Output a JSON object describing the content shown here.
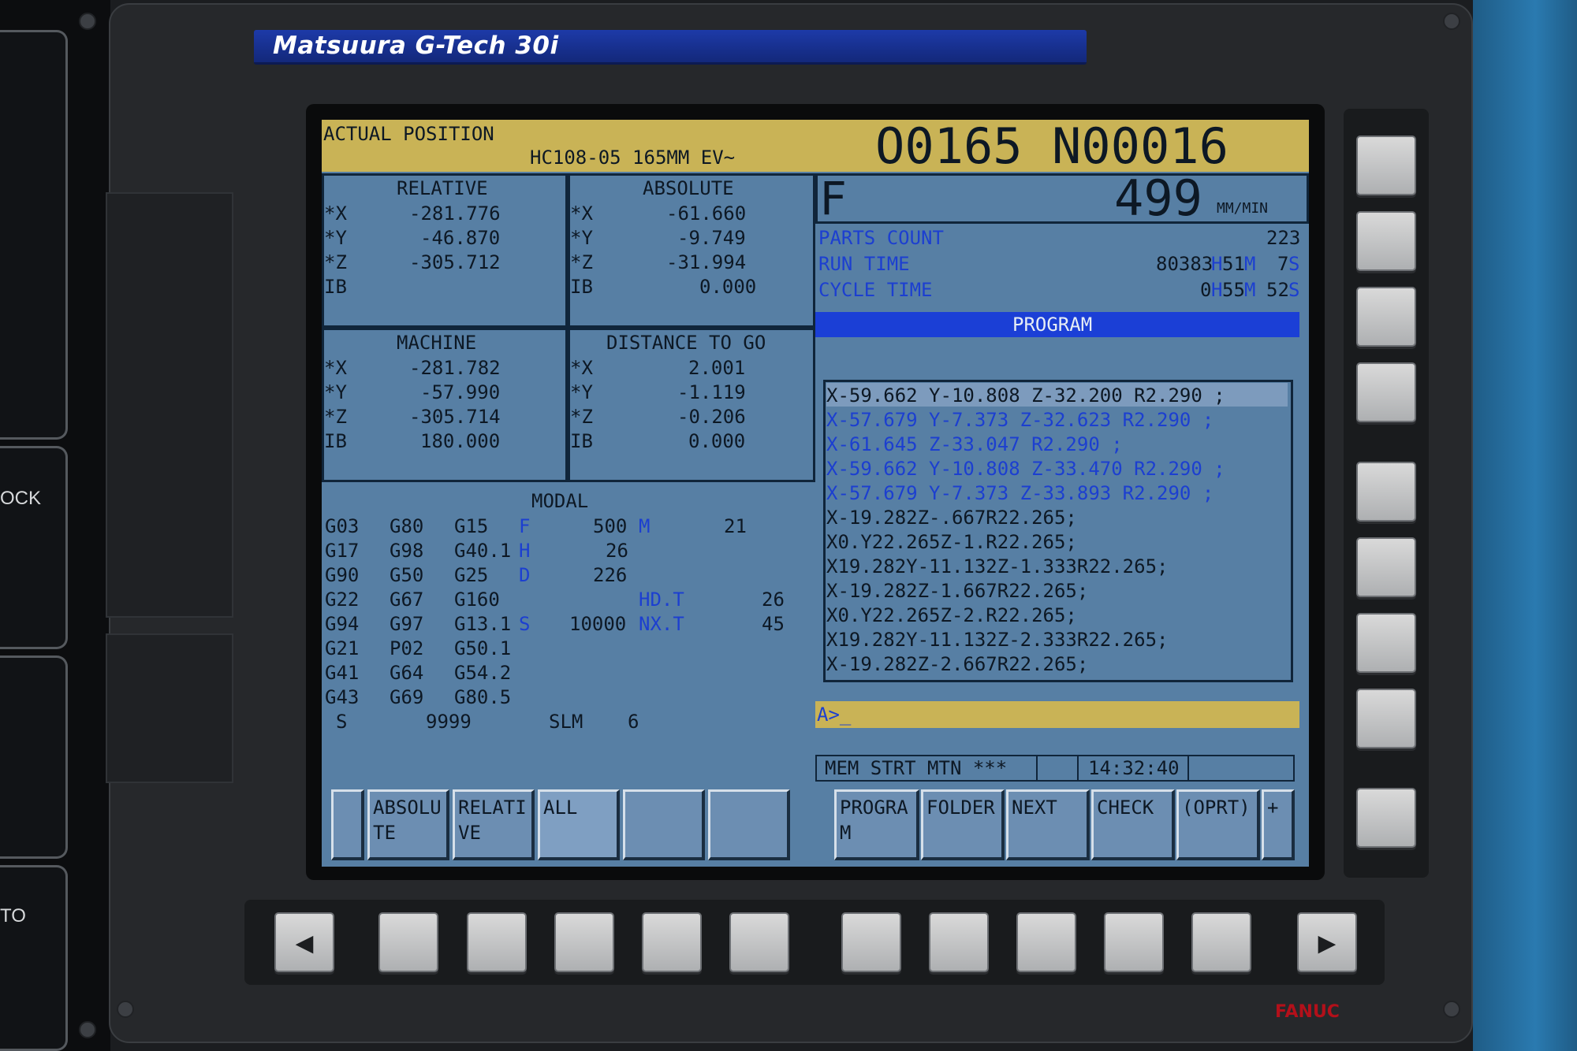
{
  "brand": {
    "title": "Matsuura G-Tech 30i",
    "logo": "FANUC"
  },
  "left_panel": {
    "labels": [
      "OCK",
      "TO"
    ]
  },
  "header": {
    "screen_title": "ACTUAL POSITION",
    "program_comment": "HC108-05 165MM EV~",
    "program_number": "O0165 N00016"
  },
  "relative": {
    "title": "RELATIVE",
    "rows": [
      [
        "*X",
        "-281.776"
      ],
      [
        "*Y",
        "-46.870"
      ],
      [
        "*Z",
        "-305.712"
      ],
      [
        "IB",
        ""
      ]
    ]
  },
  "absolute": {
    "title": "ABSOLUTE",
    "rows": [
      [
        "*X",
        "-61.660"
      ],
      [
        "*Y",
        "-9.749"
      ],
      [
        "*Z",
        "-31.994"
      ],
      [
        "IB",
        "0.000"
      ]
    ]
  },
  "machine": {
    "title": "MACHINE",
    "rows": [
      [
        "*X",
        "-281.782"
      ],
      [
        "*Y",
        "-57.990"
      ],
      [
        "*Z",
        "-305.714"
      ],
      [
        "IB",
        "180.000"
      ]
    ]
  },
  "distance_to_go": {
    "title": "DISTANCE TO GO",
    "rows": [
      [
        "*X",
        "2.001"
      ],
      [
        "*Y",
        "-1.119"
      ],
      [
        "*Z",
        "-0.206"
      ],
      [
        "IB",
        "0.000"
      ]
    ]
  },
  "feed": {
    "label": "F",
    "value": "499",
    "unit": "MM/MIN"
  },
  "counters": {
    "parts_count": {
      "label": "PARTS COUNT",
      "value": "223"
    },
    "run_time": {
      "label": "RUN TIME",
      "h": "80383",
      "h_unit": "H",
      "m": "51",
      "m_unit": "M",
      "s": "7",
      "s_unit": "S"
    },
    "cycle_time": {
      "label": "CYCLE TIME",
      "h": "0",
      "h_unit": "H",
      "m": "55",
      "m_unit": "M",
      "s": "52",
      "s_unit": "S"
    }
  },
  "program": {
    "title": "PROGRAM",
    "lines": [
      "X-59.662 Y-10.808 Z-32.200 R2.290 ;",
      "X-57.679 Y-7.373 Z-32.623 R2.290 ;",
      "X-61.645 Z-33.047 R2.290 ;",
      "X-59.662 Y-10.808 Z-33.470 R2.290 ;",
      "X-57.679 Y-7.373 Z-33.893 R2.290 ;",
      "X-19.282Z-.667R22.265;",
      "X0.Y22.265Z-1.R22.265;",
      "X19.282Y-11.132Z-1.333R22.265;",
      "X-19.282Z-1.667R22.265;",
      "X0.Y22.265Z-2.R22.265;",
      "X19.282Y-11.132Z-2.333R22.265;",
      "X-19.282Z-2.667R22.265;"
    ]
  },
  "command_line": "A>_",
  "modal": {
    "title": "MODAL",
    "gcodes": [
      [
        "G03",
        "G80",
        "G15"
      ],
      [
        "G17",
        "G98",
        "G40.1"
      ],
      [
        "G90",
        "G50",
        "G25"
      ],
      [
        "G22",
        "G67",
        "G160"
      ],
      [
        "G94",
        "G97",
        "G13.1"
      ],
      [
        "G21",
        "P02",
        "G50.1"
      ],
      [
        "G41",
        "G64",
        "G54.2"
      ],
      [
        "G43",
        "G69",
        "G80.5"
      ]
    ],
    "f_label": "F",
    "f_value": "500",
    "m_label": "M",
    "m_value": "21",
    "h_label": "H",
    "h_value": "26",
    "d_label": "D",
    "d_value": "226",
    "hdt_label": "HD.T",
    "hdt_value": "26",
    "s_label": "S",
    "s_value": "10000",
    "nxt_label": "NX.T",
    "nxt_value": "45",
    "spindle_label": "S",
    "spindle_value": "9999",
    "slm_label": "SLM",
    "slm_value": "6"
  },
  "status": {
    "mode": "MEM STRT MTN ***",
    "time": "14:32:40"
  },
  "softkeys": [
    "",
    "ABSOLUTE",
    "RELATIVE",
    "ALL",
    "",
    "",
    "PROGRAM",
    "FOLDER",
    "NEXT",
    "CHECK",
    "(OPRT)",
    "+"
  ],
  "hardkeys": {
    "left_arrow": "◀",
    "right_arrow": "▶"
  }
}
